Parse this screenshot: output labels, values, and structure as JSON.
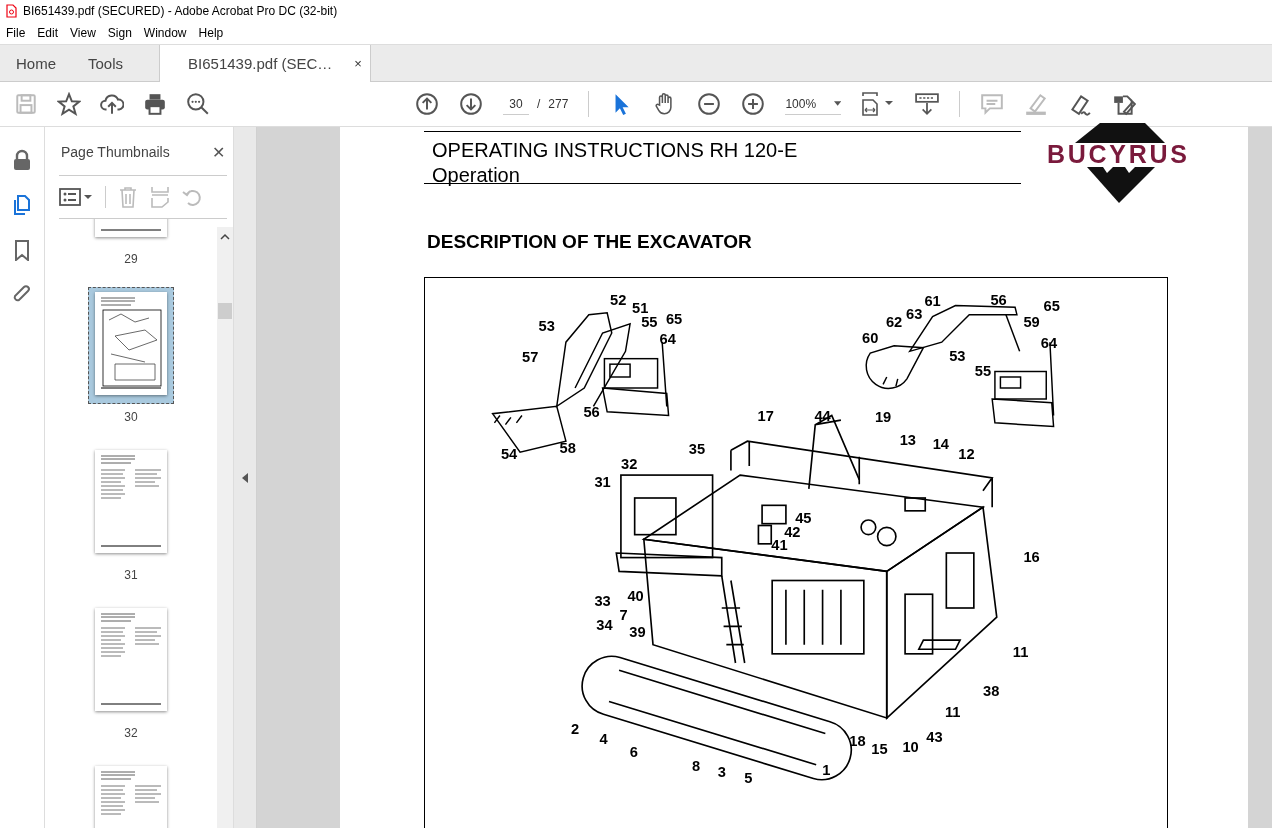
{
  "window": {
    "title": "BI651439.pdf (SECURED) - Adobe Acrobat Pro DC (32-bit)"
  },
  "menu": [
    "File",
    "Edit",
    "View",
    "Sign",
    "Window",
    "Help"
  ],
  "tabs": [
    {
      "label": "Home",
      "selected": false
    },
    {
      "label": "Tools",
      "selected": false
    },
    {
      "label": "BI651439.pdf (SEC…",
      "selected": true,
      "close": "×"
    }
  ],
  "toolbar": {
    "left_tools": [
      {
        "kind": "save",
        "disabled": true
      },
      {
        "kind": "star",
        "disabled": false
      },
      {
        "kind": "upload",
        "disabled": false
      },
      {
        "kind": "print",
        "disabled": false
      },
      {
        "kind": "search",
        "disabled": false
      }
    ],
    "page_current": "30",
    "page_separator": "/",
    "page_total": "277",
    "zoom": "100%",
    "right_tools": [
      {
        "kind": "comment",
        "disabled": true
      },
      {
        "kind": "highlight",
        "disabled": true
      },
      {
        "kind": "sign",
        "disabled": false
      },
      {
        "kind": "edit",
        "disabled": false
      }
    ]
  },
  "side_rail": [
    {
      "kind": "lock",
      "selected": false
    },
    {
      "kind": "pages",
      "selected": true
    },
    {
      "kind": "bookmark",
      "selected": false
    },
    {
      "kind": "attachment",
      "selected": false
    }
  ],
  "thumbnail_panel": {
    "title": "Page Thumbnails",
    "close": "✕",
    "thumbnails": [
      {
        "label": "29",
        "selected": false
      },
      {
        "label": "30",
        "selected": true
      },
      {
        "label": "31",
        "selected": false
      },
      {
        "label": "32",
        "selected": false
      },
      {
        "selected": false
      }
    ]
  },
  "document": {
    "header_title": "OPERATING INSTRUCTIONS RH 120-E",
    "header_subtitle": "Operation",
    "logo": "BUCYRUS",
    "heading": "DESCRIPTION OF THE EXCAVATOR",
    "callouts": [
      "52",
      "51",
      "65",
      "53",
      "55",
      "64",
      "57",
      "56",
      "58",
      "54",
      "61",
      "56",
      "65",
      "62",
      "63",
      "59",
      "60",
      "53",
      "64",
      "55",
      "17",
      "44",
      "19",
      "13",
      "14",
      "35",
      "12",
      "32",
      "31",
      "45",
      "42",
      "41",
      "16",
      "33",
      "40",
      "7",
      "34",
      "39",
      "11",
      "38",
      "2",
      "11",
      "4",
      "43",
      "6",
      "18",
      "15",
      "10",
      "8",
      "3",
      "5",
      "1"
    ]
  }
}
